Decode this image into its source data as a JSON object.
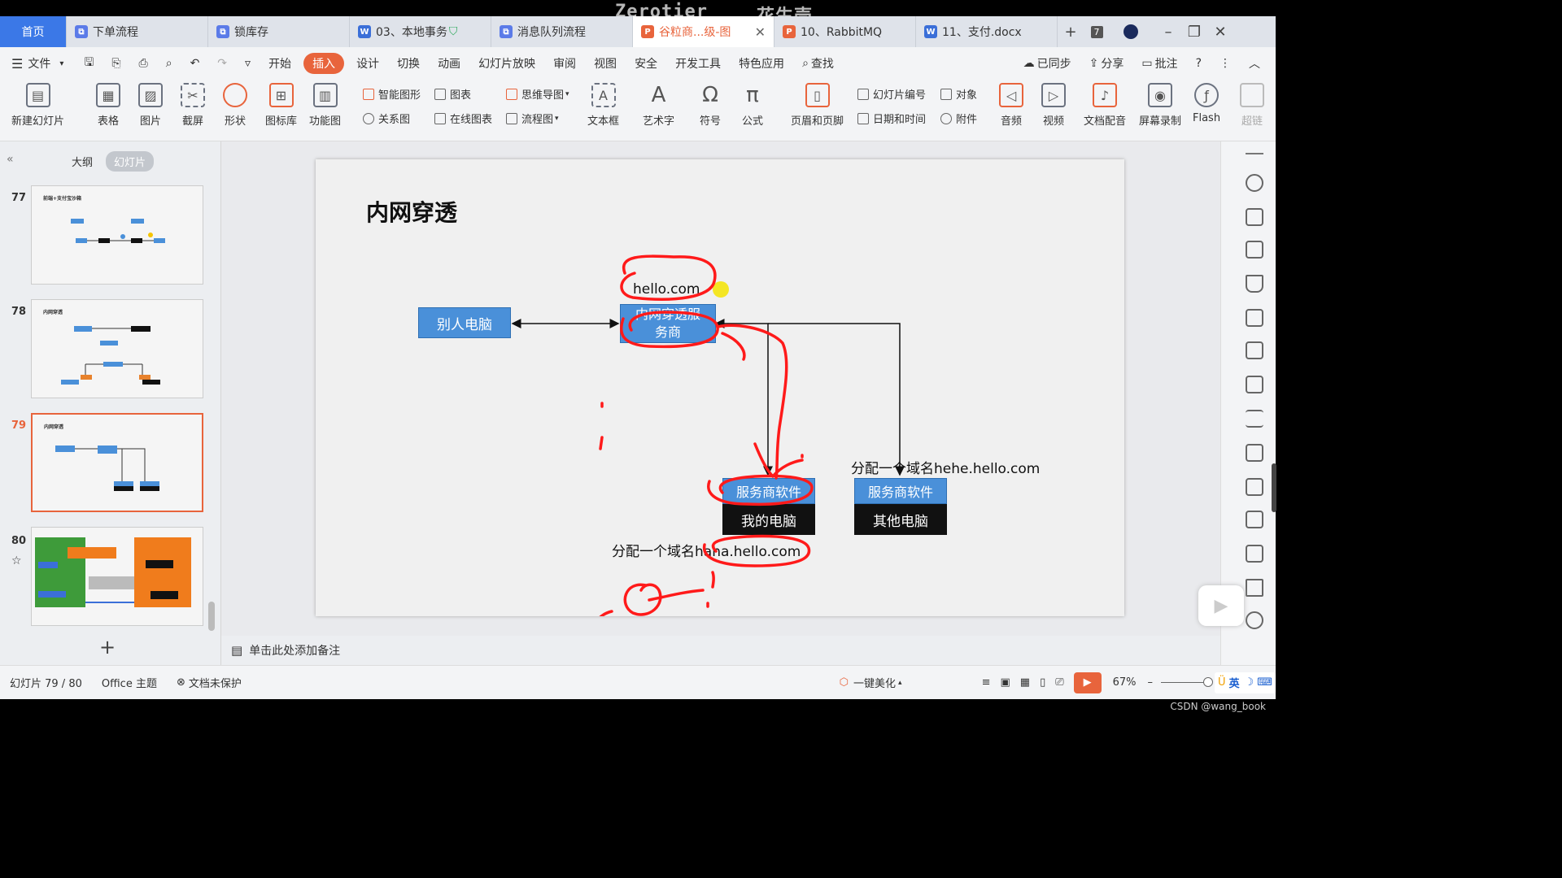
{
  "overlay": {
    "watermark_left": "Zerotier",
    "watermark_right": "花生壳",
    "csdn": "CSDN @wang_book"
  },
  "tabs": [
    {
      "label": "首页",
      "type": "home"
    },
    {
      "label": "下单流程",
      "type": "flow",
      "color": "#5b7be8"
    },
    {
      "label": "锁库存",
      "type": "flow",
      "color": "#5b7be8"
    },
    {
      "label": "03、本地事务",
      "type": "word",
      "color": "#3b6fd8"
    },
    {
      "label": "消息队列流程",
      "type": "flow",
      "color": "#5b7be8"
    },
    {
      "label": "谷粒商...级-图",
      "type": "ppt",
      "color": "#e8643c",
      "active": true
    },
    {
      "label": "10、RabbitMQ",
      "type": "ppt",
      "color": "#e8643c"
    },
    {
      "label": "11、支付.docx",
      "type": "word",
      "color": "#3b6fd8"
    }
  ],
  "tab_count": "7",
  "menu": {
    "file": "文件",
    "items": [
      "开始",
      "插入",
      "设计",
      "切换",
      "动画",
      "幻灯片放映",
      "审阅",
      "视图",
      "安全",
      "开发工具",
      "特色应用"
    ],
    "active": "插入",
    "search": "查找",
    "sync": "已同步",
    "share": "分享",
    "review": "批注"
  },
  "ribbon": {
    "big": [
      "新建幻灯片",
      "表格",
      "图片",
      "截屏",
      "形状",
      "图标库",
      "功能图",
      "文本框",
      "艺术字",
      "符号",
      "公式",
      "页眉和页脚",
      "音频",
      "视频",
      "文档配音",
      "屏幕录制",
      "Flash"
    ],
    "small": [
      "智能图形",
      "图表",
      "关系图",
      "在线图表",
      "思维导图",
      "流程图",
      "幻灯片编号",
      "对象",
      "日期和时间",
      "附件"
    ],
    "cut": "超链"
  },
  "panel": {
    "tab_outline": "大纲",
    "tab_slides": "幻灯片",
    "slides": [
      {
        "num": "77"
      },
      {
        "num": "78"
      },
      {
        "num": "79",
        "selected": true
      },
      {
        "num": "80"
      }
    ],
    "thumb77_title": "前端+支付宝沙箱",
    "thumb_titles": "内网穿透"
  },
  "slide": {
    "title": "内网穿透",
    "box_other": "别人电脑",
    "box_service": "内网穿透服务商",
    "service_line1": "内网穿透服",
    "service_line2": "务商",
    "domain_top": "hello.com",
    "sw1": "服务商软件",
    "pc1": "我的电脑",
    "sw2": "服务商软件",
    "pc2": "其他电脑",
    "assign1": "分配一个域名haha.hello.com",
    "assign2": "分配一个域名hehe.hello.com"
  },
  "notes": "单击此处添加备注",
  "status": {
    "slide_no": "幻灯片 79 / 80",
    "theme": "Office 主题",
    "protect": "文档未保护",
    "beautify": "一键美化",
    "zoom": "67%",
    "ime": "英"
  },
  "colors": {
    "accent": "#e8643c",
    "blue_box": "#4a90d9",
    "dark_box": "#111111",
    "ink": "#ff1a1a",
    "highlight": "#f5e400"
  }
}
